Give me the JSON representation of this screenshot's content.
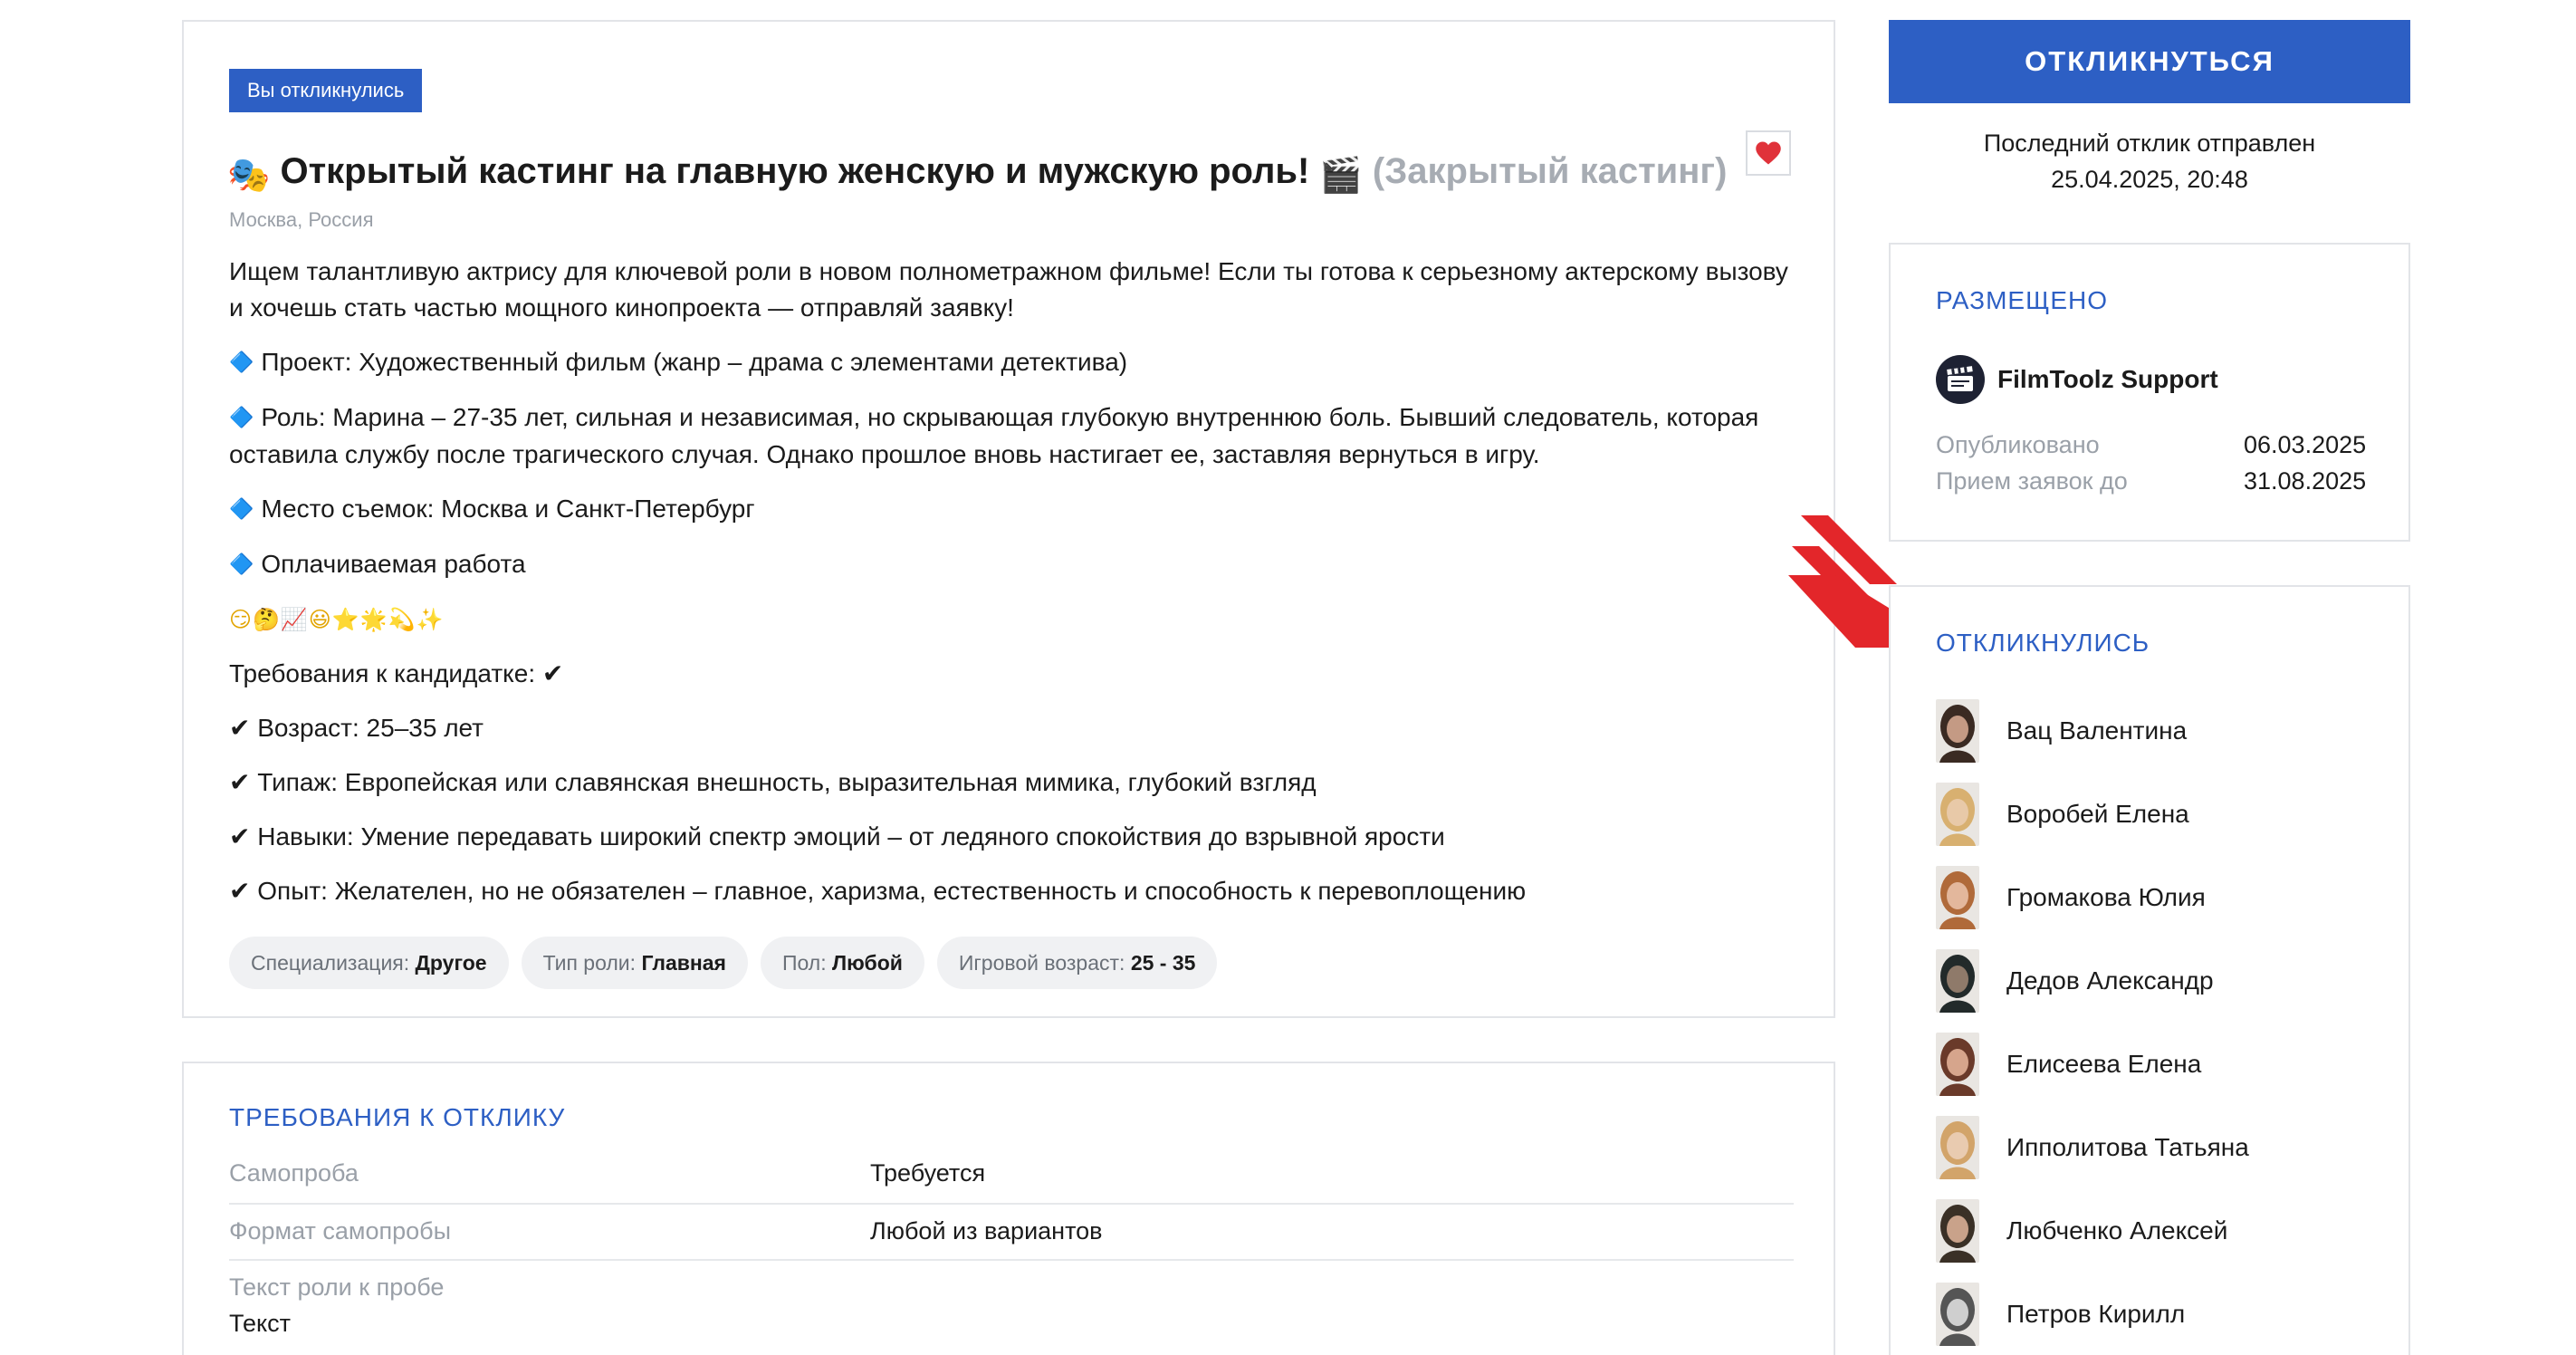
{
  "casting": {
    "badge": "Вы откликнулись",
    "title_emoji_start": "🎭",
    "title": "Открытый кастинг на главную женскую и мужскую роль!",
    "title_emoji_end": "🎬",
    "closed_label": "(Закрытый кастинг)",
    "location": "Москва, Россия",
    "intro": "Ищем талантливую актрису для ключевой роли в новом полнометражном фильме! Если ты готова к серьезному актерскому вызову и хочешь стать частью мощного кинопроекта — отправляй заявку!",
    "bullets": [
      "Проект: Художественный фильм (жанр – драма с элементами детектива)",
      "Роль: Марина – 27-35 лет, сильная и независимая, но скрывающая глубокую внутреннюю боль. Бывший следователь, которая оставила службу после трагического случая. Однако прошлое вновь настигает ее, заставляя вернуться в игру.",
      "Место съемок: Москва и Санкт-Петербург",
      "Оплачиваемая работа"
    ],
    "bullet_marker": "🔷",
    "emoji_row": "😏🤔📈😃⭐🌟💫✨",
    "requirements_heading": "Требования к кандидатке:",
    "check": "✔",
    "requirements": [
      "Возраст: 25–35 лет",
      "Типаж: Европейская или славянская внешность, выразительная мимика, глубокий взгляд",
      "Навыки: Умение передавать широкий спектр эмоций – от ледяного спокойствия до взрывной ярости",
      "Опыт: Желателен, но не обязателен – главное, харизма, естественность и способность к перевоплощению"
    ],
    "tags": [
      {
        "label": "Специализация:",
        "value": "Другое"
      },
      {
        "label": "Тип роли:",
        "value": "Главная"
      },
      {
        "label": "Пол:",
        "value": "Любой"
      },
      {
        "label": "Игровой возраст:",
        "value": "25 - 35"
      }
    ]
  },
  "response_requirements": {
    "title": "ТРЕБОВАНИЯ К ОТКЛИКУ",
    "rows": [
      {
        "label": "Самопроба",
        "value": "Требуется"
      },
      {
        "label": "Формат самопробы",
        "value": "Любой из вариантов"
      },
      {
        "label": "Текст роли к пробе",
        "value": "Текст"
      }
    ]
  },
  "sidebar": {
    "respond_button": "ОТКЛИКНУТЬСЯ",
    "last_reply_line1": "Последний отклик отправлен",
    "last_reply_line2": "25.04.2025, 20:48",
    "posted": {
      "title": "РАЗМЕЩЕНО",
      "author": "FilmToolz Support",
      "published_label": "Опубликовано",
      "published_value": "06.03.2025",
      "deadline_label": "Прием заявок до",
      "deadline_value": "31.08.2025"
    },
    "responded": {
      "title": "ОТКЛИКНУЛИСЬ",
      "people": [
        "Вац Валентина",
        "Воробей Елена",
        "Громакова Юлия",
        "Дедов Александр",
        "Елисеева Елена",
        "Ипполитова Татьяна",
        "Любченко Алексей",
        "Петров Кирилл"
      ]
    }
  },
  "colors": {
    "accent": "#2d5fc4",
    "muted": "#9aa0a8",
    "heart": "#e0323a",
    "arrow": "#e3262a"
  }
}
